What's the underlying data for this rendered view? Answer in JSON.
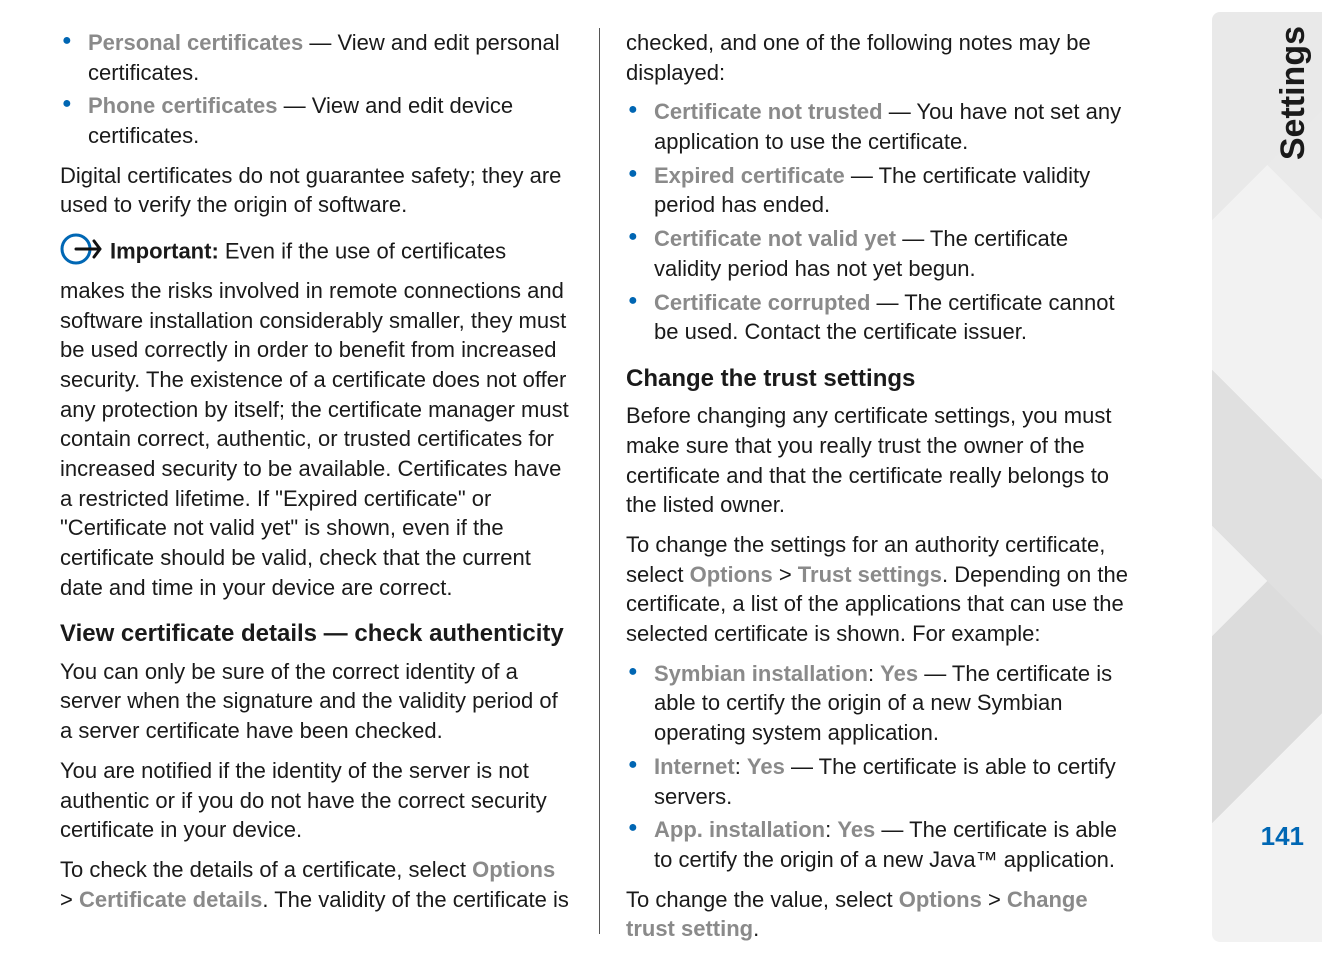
{
  "rail": {
    "section": "Settings",
    "page": "141"
  },
  "col1": {
    "items": [
      {
        "term": "Personal certificates",
        "rest": " — View and edit personal certificates."
      },
      {
        "term": "Phone certificates",
        "rest": " — View and edit device certificates."
      }
    ],
    "para1": "Digital certificates do not guarantee safety; they are used to verify the origin of software.",
    "importantLabel": "Important:",
    "importantText": " Even if the use of certificates makes the risks involved in remote connections and software installation considerably smaller, they must be used correctly in order to benefit from increased security. The existence of a certificate does not offer any protection by itself; the certificate manager must contain correct, authentic, or trusted certificates for increased security to be available. Certificates have a restricted lifetime. If \"Expired certificate\" or \"Certificate not valid yet\" is shown, even if the certificate should be valid, check that the current date and time in your device are correct.",
    "subhead1": "View certificate details — check authenticity",
    "para2": "You can only be sure of the correct identity of a server when the signature and the validity period of a server certificate have been checked.",
    "para3": "You are notified if the identity of the server is not authentic or if you do not have the correct security certificate in your device.",
    "para4_a": "To check the details of a certificate, select ",
    "para4_opt1": "Options",
    "para4_gt": " > ",
    "para4_opt2": "Certificate details",
    "para4_b": ". The validity of the certificate is"
  },
  "col2": {
    "contPara": "checked, and one of the following notes may be displayed:",
    "notes": [
      {
        "term": "Certificate not trusted",
        "rest": " — You have not set any application to use the certificate."
      },
      {
        "term": "Expired certificate",
        "rest": " — The certificate validity period has ended."
      },
      {
        "term": "Certificate not valid yet",
        "rest": " — The certificate validity period has not yet begun."
      },
      {
        "term": "Certificate corrupted",
        "rest": " — The certificate cannot be used. Contact the certificate issuer."
      }
    ],
    "subhead2": "Change the trust settings",
    "para5": "Before changing any certificate settings, you must make sure that you really trust the owner of the certificate and that the certificate really belongs to the listed owner.",
    "para6_a": "To change the settings for an authority certificate, select ",
    "para6_opt1": "Options",
    "para6_gt": " > ",
    "para6_opt2": "Trust settings",
    "para6_b": ". Depending on the certificate, a list of the applications that can use the selected certificate is shown. For example:",
    "examples": [
      {
        "term": "Symbian installation",
        "val": "Yes",
        "rest": " — The certificate is able to certify the origin of a new Symbian operating system application."
      },
      {
        "term": "Internet",
        "val": "Yes",
        "rest": " — The certificate is able to certify servers."
      },
      {
        "term": "App. installation",
        "val": "Yes",
        "rest": " — The certificate is able to certify the origin of a new Java™ application."
      }
    ],
    "para7_a": "To change the value, select ",
    "para7_opt1": "Options",
    "para7_gt": " > ",
    "para7_opt2": "Change trust setting",
    "para7_b": "."
  }
}
